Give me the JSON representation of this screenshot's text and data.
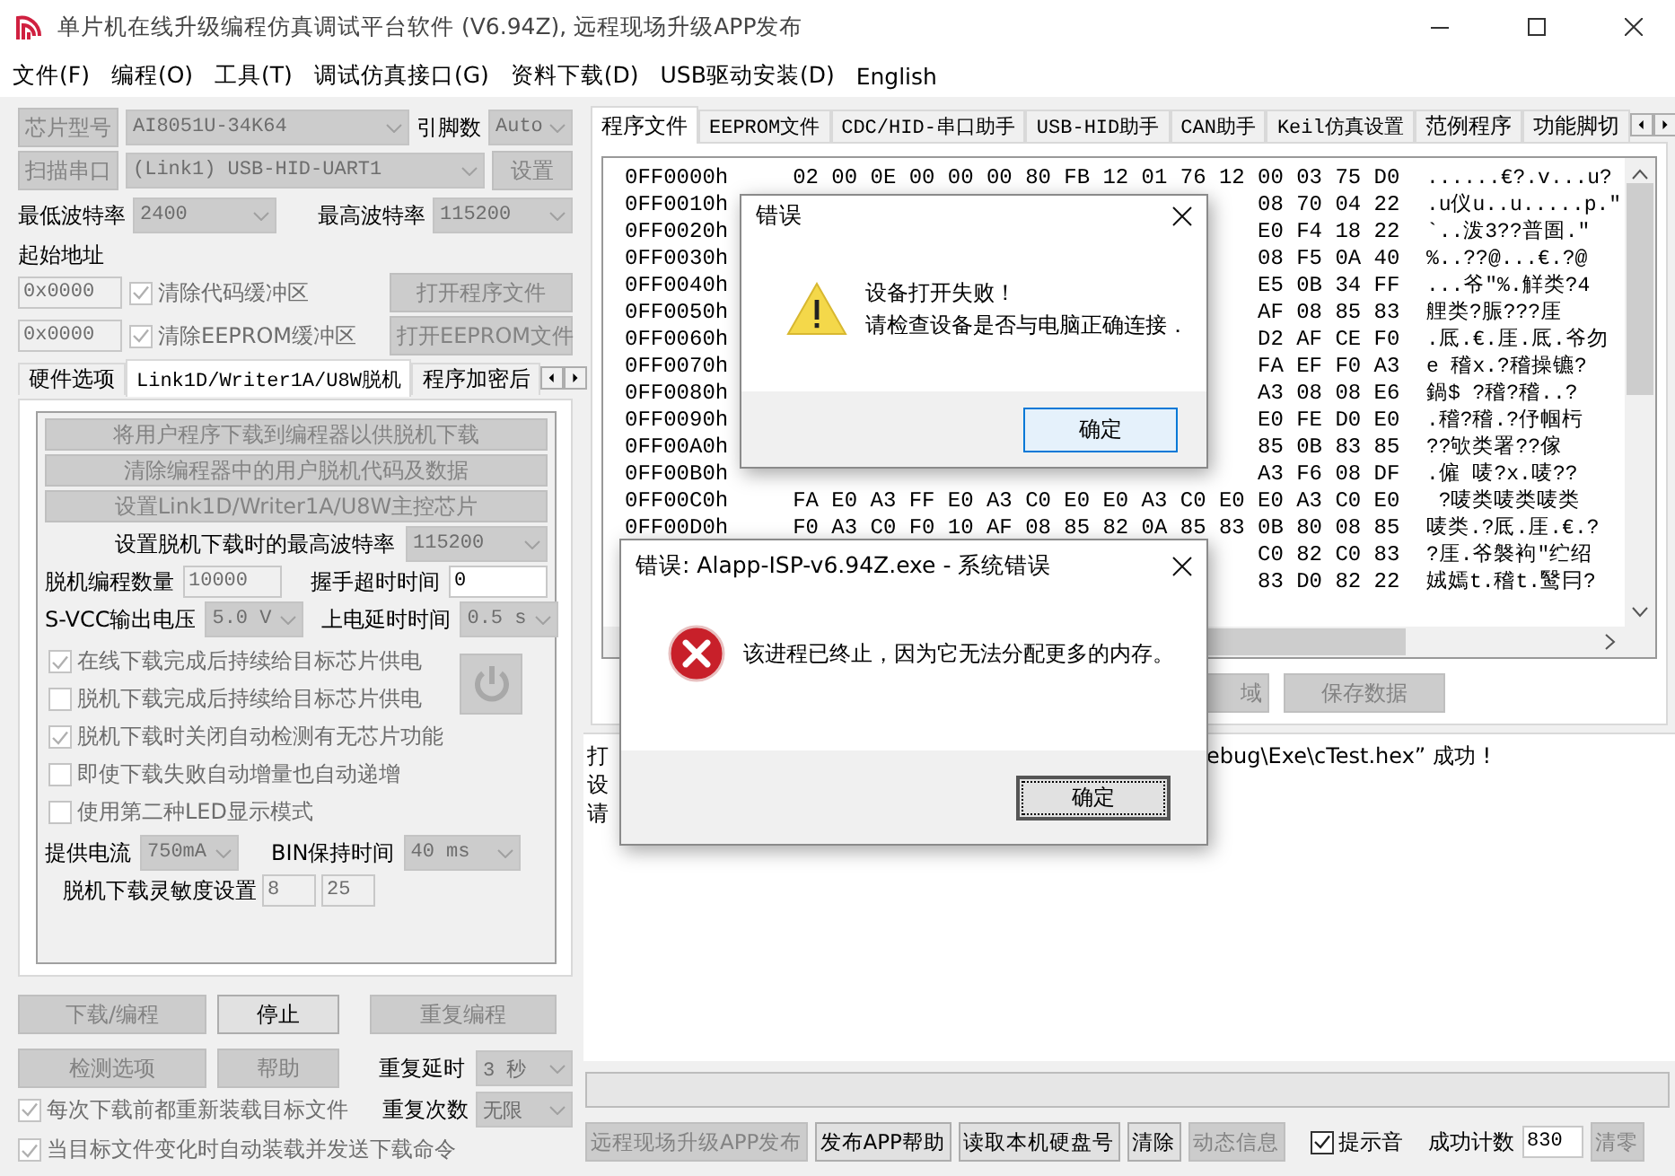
{
  "window": {
    "title": "单片机在线升级编程仿真调试平台软件 (V6.94Z), 远程现场升级APP发布"
  },
  "menu": [
    "文件(F)",
    "编程(O)",
    "工具(T)",
    "调试仿真接口(G)",
    "资料下载(D)",
    "USB驱动安装(D)",
    "English"
  ],
  "left": {
    "chip": {
      "button": {
        "label": "芯片型号",
        "disabled": true
      },
      "value": "AI8051U-34K64",
      "pins_label": "引脚数",
      "pins": "Auto"
    },
    "port": {
      "button": {
        "label": "扫描串口",
        "disabled": true
      },
      "value": "(Link1) USB-HID-UART1",
      "settings": {
        "label": "设置",
        "disabled": true
      }
    },
    "baud": {
      "min_label": "最低波特率",
      "min": "2400",
      "max_label": "最高波特率",
      "max": "115200"
    },
    "start_address_label": "起始地址",
    "address_rows": [
      {
        "address": "0x0000",
        "option": {
          "label": "清除代码缓冲区",
          "checked": true,
          "disabled": true
        },
        "button": {
          "label": "打开程序文件",
          "disabled": true
        }
      },
      {
        "address": "0x0000",
        "option": {
          "label": "清除EEPROM缓冲区",
          "checked": true,
          "disabled": true
        },
        "button": {
          "label": "打开EEPROM文件",
          "disabled": true
        }
      }
    ],
    "tabs": [
      {
        "label": "硬件选项",
        "selected": false
      },
      {
        "label": "Link1D/Writer1A/U8W脱机",
        "selected": true
      },
      {
        "label": "程序加密后",
        "selected": false
      }
    ],
    "offline": {
      "actions": [
        {
          "label": "将用户程序下载到编程器以供脱机下载",
          "disabled": true
        },
        {
          "label": "清除编程器中的用户脱机代码及数据",
          "disabled": true
        },
        {
          "label": "设置Link1D/Writer1A/U8W主控芯片",
          "disabled": true
        }
      ],
      "max_baud_label": "设置脱机下载时的最高波特率",
      "max_baud": "115200",
      "count_label": "脱机编程数量",
      "count": "10000",
      "timeout_label": "握手超时时间",
      "timeout": "0",
      "vcc_label": "S-VCC输出电压",
      "vcc": "5.0 V",
      "delay_label": "上电延时时间",
      "delay": "0.5 s",
      "options": [
        {
          "label": "在线下载完成后持续给目标芯片供电",
          "checked": true,
          "disabled": true
        },
        {
          "label": "脱机下载完成后持续给目标芯片供电",
          "checked": false,
          "disabled": true
        },
        {
          "label": "脱机下载时关闭自动检测有无芯片功能",
          "checked": true,
          "disabled": true
        },
        {
          "label": "即使下载失败自动增量也自动递增",
          "checked": false,
          "disabled": true
        },
        {
          "label": "使用第二种LED显示模式",
          "checked": false,
          "disabled": true
        }
      ],
      "current_label": "提供电流",
      "current": "750mA",
      "bin_label": "BIN保持时间",
      "bin": "40 ms",
      "sensitivity_label": "脱机下载灵敏度设置",
      "sensitivity": [
        "8",
        "25"
      ]
    },
    "actions": [
      {
        "label": "下载/编程",
        "disabled": true
      },
      {
        "label": "停止",
        "disabled": false
      },
      {
        "label": "重复编程",
        "disabled": true
      }
    ],
    "actions2": [
      {
        "label": "检测选项",
        "disabled": true
      },
      {
        "label": "帮助",
        "disabled": true
      }
    ],
    "repeat_delay": {
      "label": "重复延时",
      "value": "3 秒"
    },
    "repeat_count": {
      "label": "重复次数",
      "value": "无限"
    },
    "auto_options": [
      {
        "label": "每次下载前都重新装载目标文件",
        "checked": true,
        "disabled": true
      },
      {
        "label": "当目标文件变化时自动装载并发送下载命令",
        "checked": true,
        "disabled": true
      }
    ]
  },
  "right": {
    "tabs": [
      {
        "label": "程序文件",
        "selected": true
      },
      {
        "label": "EEPROM文件",
        "selected": false
      },
      {
        "label": "CDC/HID-串口助手",
        "selected": false
      },
      {
        "label": "USB-HID助手",
        "selected": false
      },
      {
        "label": "CAN助手",
        "selected": false
      },
      {
        "label": "Keil仿真设置",
        "selected": false
      },
      {
        "label": "范例程序",
        "selected": false
      },
      {
        "label": "功能脚切",
        "selected": false
      }
    ],
    "hex_rows": [
      {
        "address": "0FF0000h",
        "bytes": [
          "02",
          "00",
          "0E",
          "00",
          "00",
          "00",
          "80",
          "FB",
          "12",
          "01",
          "76",
          "12",
          "00",
          "03",
          "75",
          "D0"
        ],
        "ascii": "......€?.v...u?"
      },
      {
        "address": "0FF0010h",
        "bytes": [
          "08",
          "70",
          "04",
          "22"
        ],
        "ascii": ".u仪u..u.....p.\""
      },
      {
        "address": "0FF0020h",
        "bytes": [
          "E0",
          "F4",
          "18",
          "22"
        ],
        "ascii": "`..泼3??普圄.\""
      },
      {
        "address": "0FF0030h",
        "bytes": [
          "08",
          "F5",
          "0A",
          "40"
        ],
        "ascii": "%..??@...€.?@"
      },
      {
        "address": "0FF0040h",
        "bytes": [
          "E5",
          "0B",
          "34",
          "FF"
        ],
        "ascii": "...爷\"%.觧类?4"
      },
      {
        "address": "0FF0050h",
        "bytes": [
          "AF",
          "08",
          "85",
          "83"
        ],
        "ascii": "艃类?脤???厓"
      },
      {
        "address": "0FF0060h",
        "bytes": [
          "D2",
          "AF",
          "CE",
          "F0"
        ],
        "ascii": ".厎.€.厓.厎.爷勿"
      },
      {
        "address": "0FF0070h",
        "bytes": [
          "FA",
          "EF",
          "F0",
          "A3"
        ],
        "ascii": "e 稽x.?稽操镳?"
      },
      {
        "address": "0FF0080h",
        "bytes": [
          "A3",
          "08",
          "08",
          "E6"
        ],
        "ascii": "鍋$ ?稽?稽..?"
      },
      {
        "address": "0FF0090h",
        "bytes": [
          "E0",
          "FE",
          "D0",
          "E0"
        ],
        "ascii": ".稽?稽.?伃帼杇"
      },
      {
        "address": "0FF00A0h",
        "bytes": [
          "85",
          "0B",
          "83",
          "85"
        ],
        "ascii": "??欨类署??傢"
      },
      {
        "address": "0FF00B0h",
        "bytes": [
          "A3",
          "F6",
          "08",
          "DF"
        ],
        "ascii": ".僱 唛?x.唛??"
      },
      {
        "address": "0FF00C0h",
        "bytes": [
          "FA",
          "E0",
          "A3",
          "FF",
          "E0",
          "A3",
          "C0",
          "E0",
          "E0",
          "A3",
          "C0",
          "E0",
          "E0",
          "A3",
          "C0",
          "E0"
        ],
        "ascii": " ?唛类唛类唛类"
      },
      {
        "address": "0FF00D0h",
        "bytes": [
          "F0",
          "A3",
          "C0",
          "F0",
          "10",
          "AF",
          "08",
          "85",
          "82",
          "0A",
          "85",
          "83",
          "0B",
          "80",
          "08",
          "85"
        ],
        "ascii": "唛类.?厎.厓.€.?"
      },
      {
        "bytes": [
          "C0",
          "82",
          "C0",
          "83"
        ],
        "ascii": "?厓.爷褩袧\"纻绍"
      },
      {
        "bytes": [
          "83",
          "D0",
          "82",
          "22"
        ],
        "ascii": "娀嫣t.稽t.鹥冃?"
      }
    ],
    "buttons": [
      {
        "label": "域",
        "disabled": true
      },
      {
        "label": "保存数据",
        "disabled": true
      }
    ],
    "log": [
      {
        "start": "打",
        "end": "ebug\\Exe\\cTest.hex” 成功 !"
      },
      {
        "start": "设"
      },
      {
        "start": "请"
      }
    ],
    "progress": {
      "level": 0
    },
    "bottom_buttons": [
      {
        "label": "远程现场升级APP发布",
        "disabled": true
      },
      {
        "label": "发布APP帮助",
        "disabled": false
      },
      {
        "label": "读取本机硬盘号",
        "disabled": false
      },
      {
        "label": "清除",
        "disabled": false
      },
      {
        "label": "动态信息",
        "disabled": true
      }
    ],
    "beep": {
      "label": "提示音",
      "checked": true,
      "disabled": false
    },
    "count_label": "成功计数",
    "count": "830",
    "reset": {
      "label": "清零",
      "disabled": true
    }
  },
  "dialogs": [
    {
      "kind": "warning",
      "title": "错误",
      "message": [
        "设备打开失败！",
        "请检查设备是否与电脑正确连接．"
      ],
      "button": "确定"
    },
    {
      "kind": "error",
      "title": "错误: Alapp-ISP-v6.94Z.exe - 系统错误",
      "message": [
        "该进程已终止，因为它无法分配更多的内存。"
      ],
      "button": "确定"
    }
  ]
}
